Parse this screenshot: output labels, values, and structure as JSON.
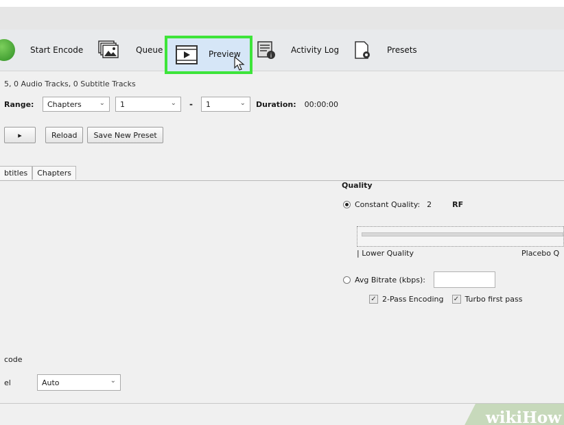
{
  "toolbar": {
    "start_encode": "Start Encode",
    "queue": "Queue",
    "preview": "Preview",
    "activity_log": "Activity Log",
    "presets": "Presets"
  },
  "source_info": "5, 0 Audio Tracks, 0 Subtitle Tracks",
  "range": {
    "label": "Range:",
    "mode": "Chapters",
    "start": "1",
    "separator": "-",
    "end": "1",
    "duration_label": "Duration:",
    "duration_value": "00:00:00"
  },
  "preset_buttons": {
    "reload": "Reload",
    "save_new_preset": "Save New Preset"
  },
  "tabs": [
    "btitles",
    "Chapters"
  ],
  "quality": {
    "heading": "Quality",
    "constant_label": "Constant Quality:",
    "constant_value": "2",
    "rf_label": "RF",
    "lower_quality": "| Lower Quality",
    "placebo": "Placebo Q",
    "avg_bitrate_label": "Avg Bitrate (kbps):",
    "avg_bitrate_value": "",
    "two_pass": "2-Pass Encoding",
    "turbo": "Turbo first pass"
  },
  "encoder": {
    "section_label": "code",
    "level_label": "el",
    "level_value": "Auto"
  },
  "watermark": "wikiHow",
  "colors": {
    "highlight_border": "#3ee43a",
    "preview_bg": "#d6e6f7",
    "start_green": "#2f8f25"
  }
}
